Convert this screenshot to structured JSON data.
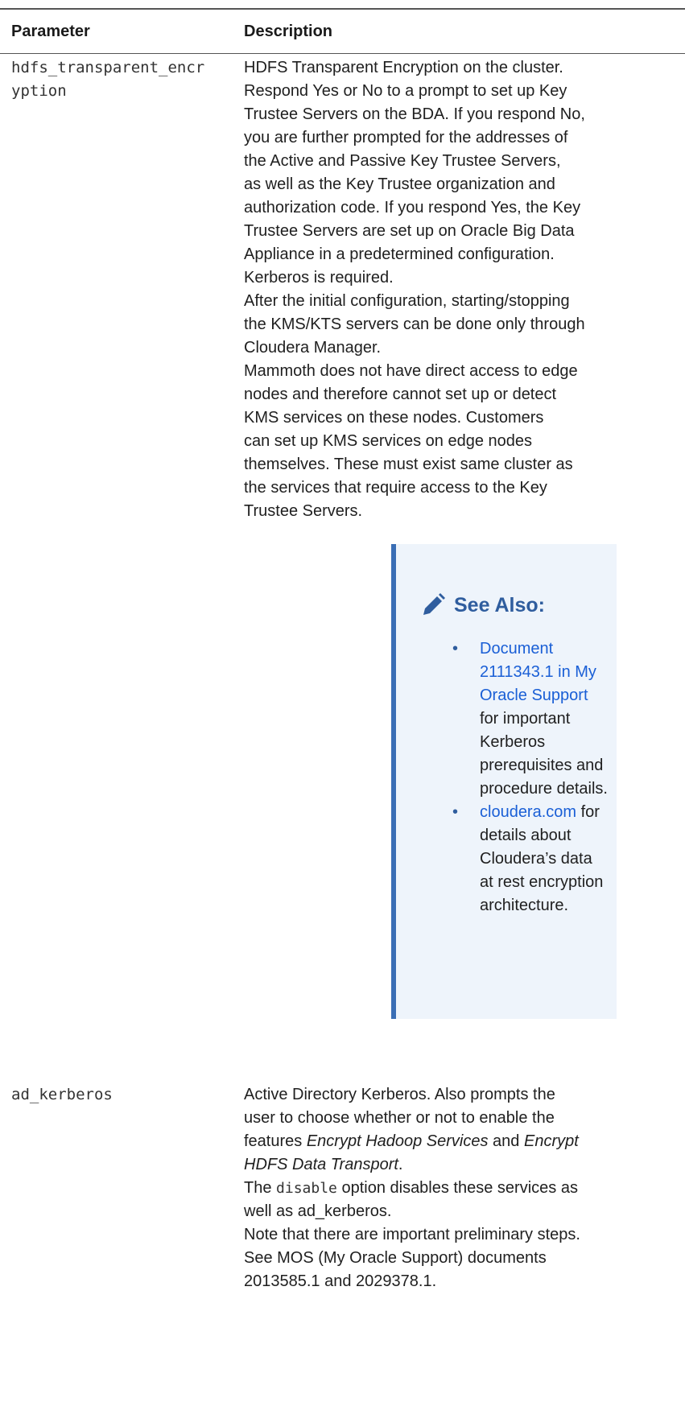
{
  "table": {
    "headers": [
      "Parameter",
      "Description"
    ],
    "rows": [
      {
        "param_line1": "hdfs_transparent_encr",
        "param_line2": "yption",
        "desc_lines": [
          "HDFS Transparent Encryption on the cluster.",
          "Respond Yes or No to a prompt to set up Key",
          "Trustee Servers on the BDA. If you respond No,",
          "you are further prompted for the addresses of",
          "the Active and Passive Key Trustee Servers,",
          "as well as the Key Trustee organization and",
          "authorization code. If you respond Yes, the Key",
          "Trustee Servers are set up on Oracle Big Data",
          "Appliance in a predetermined configuration.",
          "Kerberos is required.",
          "After the initial configuration, starting/stopping",
          "the KMS/KTS servers can be done only through",
          "Cloudera Manager.",
          "Mammoth does not have direct access to edge",
          "nodes and therefore cannot set up or detect",
          "KMS services on these nodes. Customers",
          "can set up KMS services on edge nodes",
          "themselves. These must exist same cluster as",
          "the services that require access to the Key",
          "Trustee Servers."
        ],
        "note": {
          "icon": "pencil-icon",
          "title": "See Also:",
          "item1_link": "Document 2111343.1 in My Oracle Support",
          "item1_text": " for important Kerberos prerequisites and procedure details.",
          "item2_link": "cloudera.com",
          "item2_text": " for details about Cloudera’s data at rest encryption architecture."
        }
      },
      {
        "param": "ad_kerberos",
        "line1": "Active Directory Kerberos. Also prompts the",
        "line2": "user to choose whether or not to enable the",
        "line3_a": "features ",
        "line3_em1": "Encrypt Hadoop Services",
        "line3_b": " and ",
        "line3_em2a": "Encrypt",
        "line4_em": "HDFS Data Transport",
        "line4_b": ".",
        "line5_a": "The ",
        "line5_code": "disable",
        "line5_b": " option disables these services as",
        "line6": "well as ad_kerberos.",
        "line7": "Note that there are important preliminary steps.",
        "line8": "See MOS (My Oracle Support) documents",
        "line9": "2013585.1 and 2029378.1."
      }
    ]
  },
  "colors": {
    "accent": "#3a6eb5",
    "note_bg": "#eef4fb",
    "link": "#1a5fd6"
  }
}
